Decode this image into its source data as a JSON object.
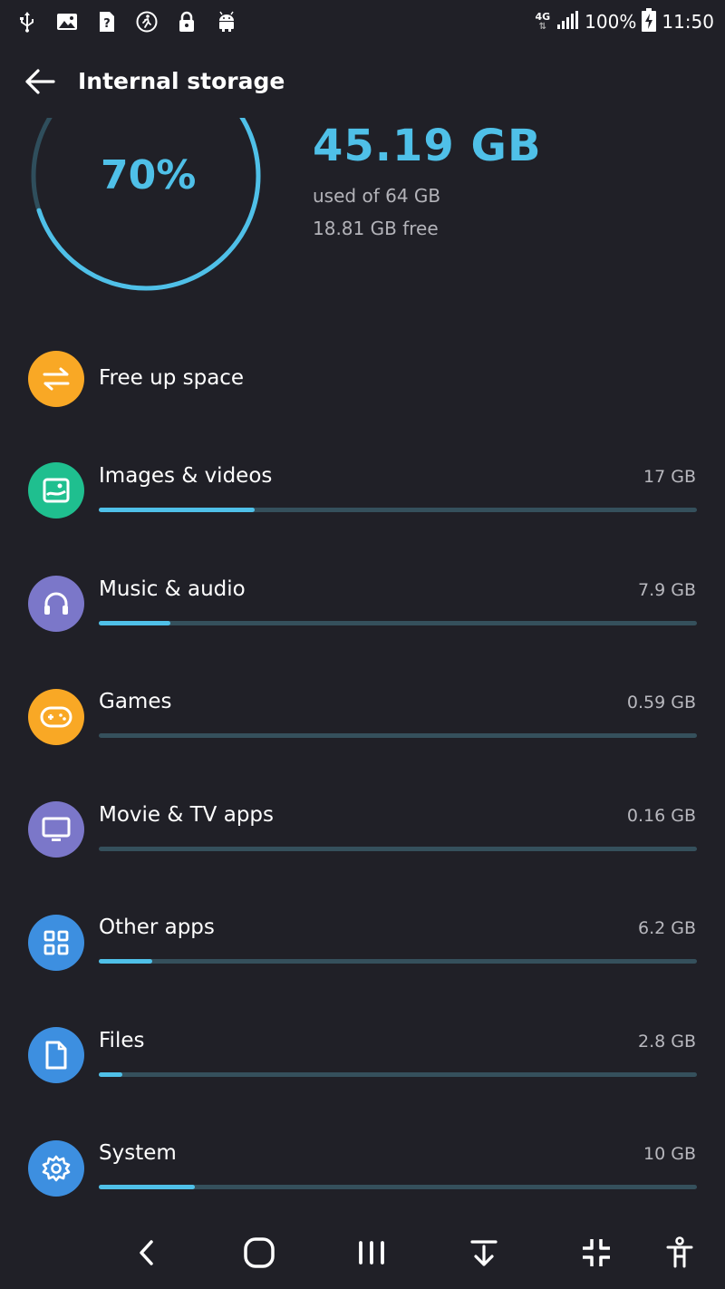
{
  "status_bar": {
    "network": "4G",
    "battery": "100%",
    "time": "11:50",
    "left_icons": [
      "usb-icon",
      "image-icon",
      "unknown-app-icon",
      "running-icon",
      "lock-icon",
      "android-icon"
    ]
  },
  "app_bar": {
    "title": "Internal storage"
  },
  "summary": {
    "percent_text": "70%",
    "percent_value": 0.7,
    "used": "45.19 GB",
    "used_of": "used of 64 GB",
    "free": "18.81 GB free"
  },
  "free_up": {
    "label": "Free up space",
    "color": "#f9a825"
  },
  "categories": [
    {
      "label": "Images & videos",
      "size": "17 GB",
      "fraction": 0.26,
      "color": "#1fbf8f",
      "icon": "image-icon"
    },
    {
      "label": "Music & audio",
      "size": "7.9 GB",
      "fraction": 0.12,
      "color": "#7b77c9",
      "icon": "headphones-icon"
    },
    {
      "label": "Games",
      "size": "0.59 GB",
      "fraction": 0.0,
      "color": "#f9a825",
      "icon": "gamepad-icon"
    },
    {
      "label": "Movie & TV apps",
      "size": "0.16 GB",
      "fraction": 0.0,
      "color": "#7b77c9",
      "icon": "tv-icon"
    },
    {
      "label": "Other apps",
      "size": "6.2 GB",
      "fraction": 0.09,
      "color": "#3d8fe0",
      "icon": "apps-grid-icon"
    },
    {
      "label": "Files",
      "size": "2.8 GB",
      "fraction": 0.04,
      "color": "#3d8fe0",
      "icon": "file-icon"
    },
    {
      "label": "System",
      "size": "10 GB",
      "fraction": 0.16,
      "color": "#3d8fe0",
      "icon": "gear-icon"
    }
  ],
  "nav_bar": [
    "back-icon",
    "home-icon",
    "recents-icon",
    "collapse-down-icon",
    "minimize-icon",
    "accessibility-icon"
  ],
  "colors": {
    "accent": "#4fc0e8",
    "background": "#202027",
    "track": "#35505c"
  }
}
